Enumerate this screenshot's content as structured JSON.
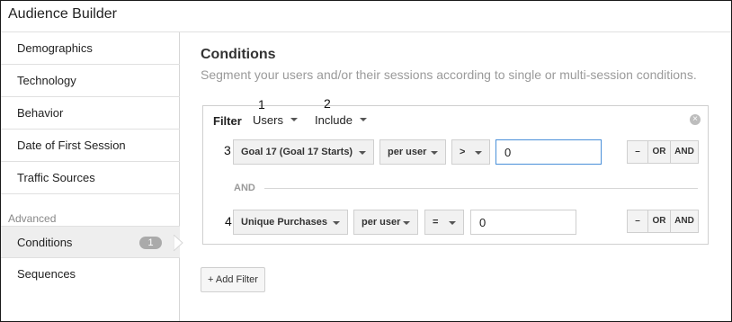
{
  "app": {
    "title": "Audience Builder"
  },
  "sidebar": {
    "items": [
      {
        "label": "Demographics"
      },
      {
        "label": "Technology"
      },
      {
        "label": "Behavior"
      },
      {
        "label": "Date of First Session"
      },
      {
        "label": "Traffic Sources"
      }
    ],
    "section_label": "Advanced",
    "advanced_items": [
      {
        "label": "Conditions",
        "badge": "1",
        "active": true
      },
      {
        "label": "Sequences"
      }
    ]
  },
  "main": {
    "title": "Conditions",
    "subtitle": "Segment your users and/or their sessions according to single or multi-session conditions."
  },
  "filter": {
    "label": "Filter",
    "scope": "Users",
    "mode": "Include",
    "markers": [
      "1",
      "2",
      "3",
      "4"
    ],
    "separator": "AND",
    "rows": [
      {
        "metric": "Goal 17 (Goal 17 Starts)",
        "per": "per user",
        "operator": ">",
        "value": "0",
        "focused": true
      },
      {
        "metric": "Unique Purchases",
        "per": "per user",
        "operator": "=",
        "value": "0",
        "focused": false
      }
    ],
    "buttons": {
      "remove": "–",
      "or": "OR",
      "and": "AND"
    }
  },
  "add_filter": {
    "label": "+ Add Filter"
  },
  "colors": {
    "focus_border": "#4a90d9",
    "badge_bg": "#aaaaaa",
    "active_bg": "#eeeeee"
  }
}
